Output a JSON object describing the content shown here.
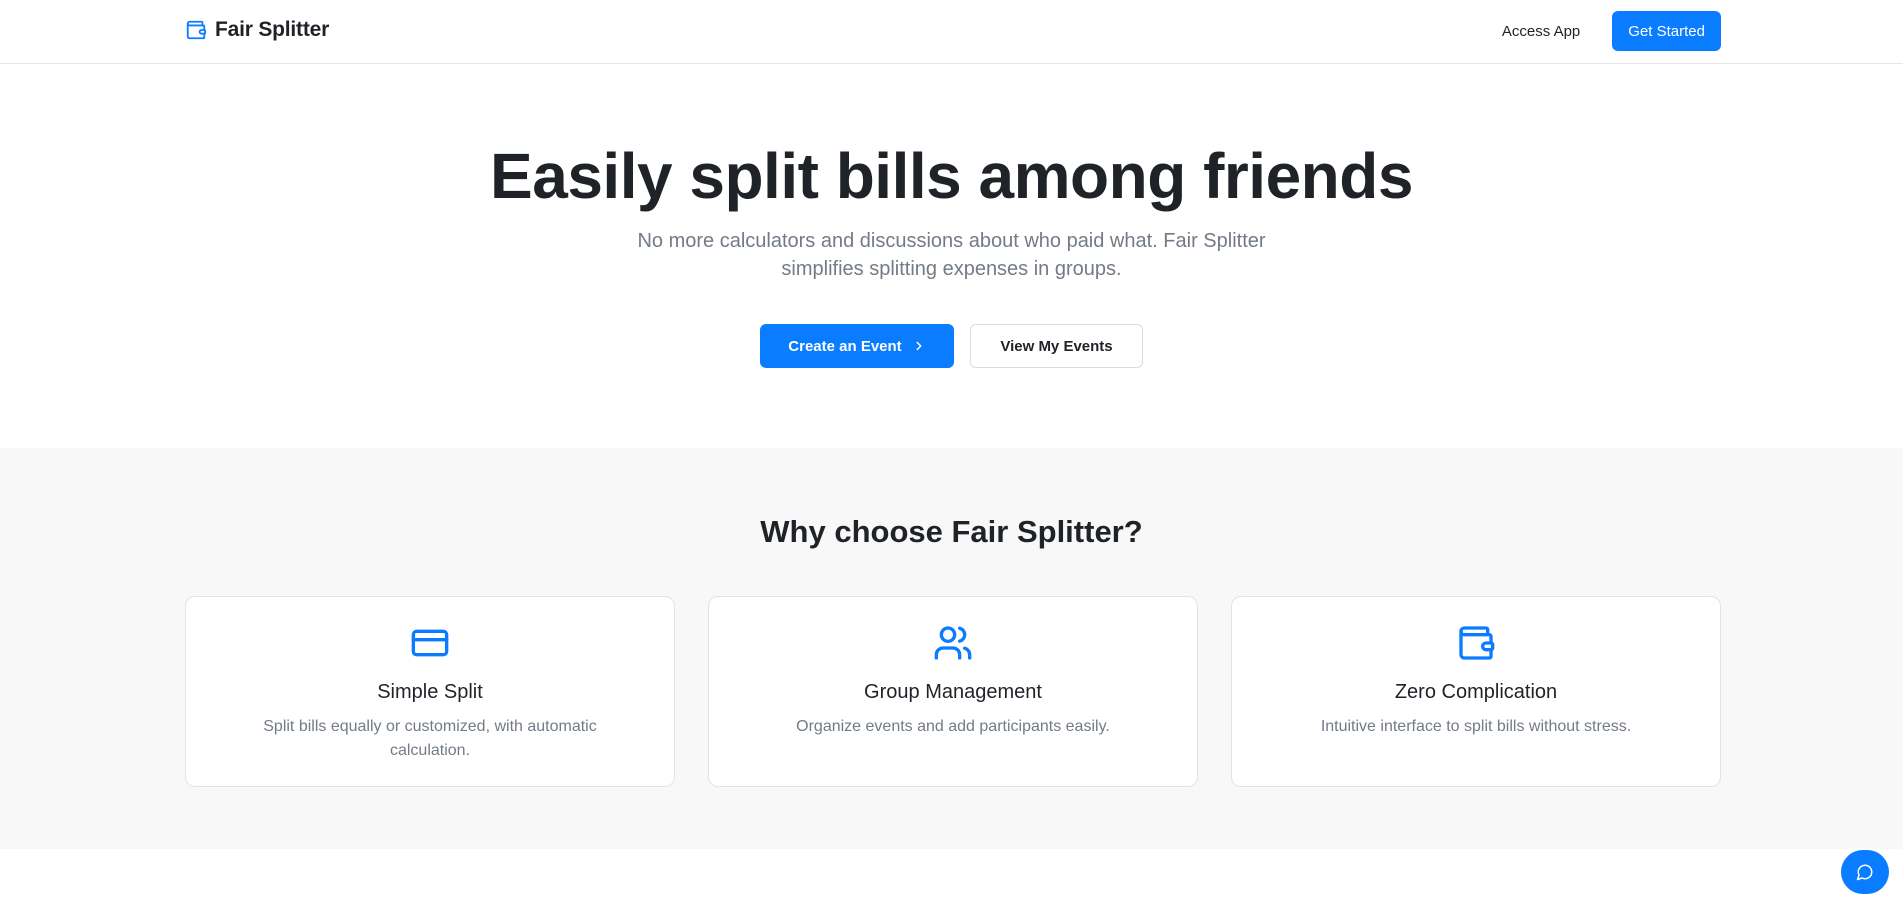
{
  "header": {
    "brand": {
      "name": "Fair Splitter",
      "icon": "wallet-icon"
    },
    "nav": {
      "access_label": "Access App",
      "get_started_label": "Get Started"
    }
  },
  "hero": {
    "title": "Easily split bills among friends",
    "subtitle": "No more calculators and discussions about who paid what. Fair Splitter simplifies splitting expenses in groups.",
    "primary_cta": "Create an Event",
    "secondary_cta": "View My Events"
  },
  "features": {
    "title": "Why choose Fair Splitter?",
    "cards": [
      {
        "icon": "credit-card-icon",
        "title": "Simple Split",
        "description": "Split bills equally or customized, with automatic calculation."
      },
      {
        "icon": "users-icon",
        "title": "Group Management",
        "description": "Organize events and add participants easily."
      },
      {
        "icon": "wallet-icon",
        "title": "Zero Complication",
        "description": "Intuitive interface to split bills without stress."
      }
    ]
  },
  "chat": {
    "icon": "chat-bubble-icon"
  },
  "colors": {
    "accent": "#0a7cff",
    "muted_text": "#737b86",
    "section_bg": "#f8f8f8"
  }
}
